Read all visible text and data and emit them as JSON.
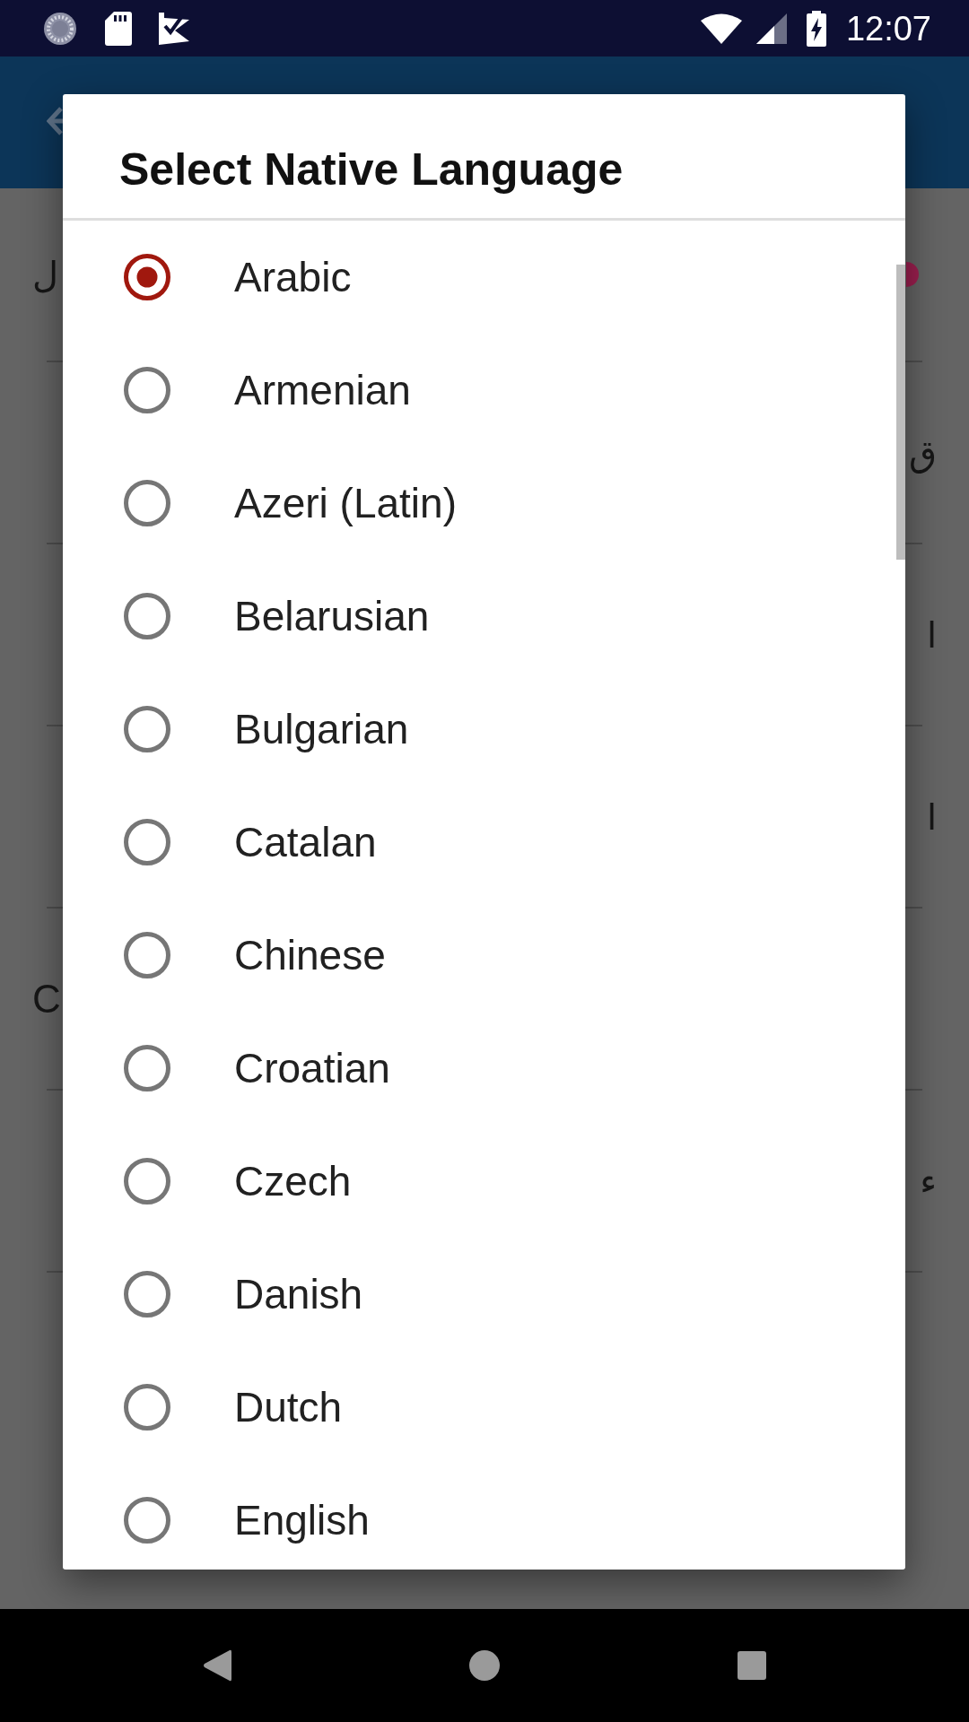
{
  "status_bar": {
    "time": "12:07"
  },
  "background_list": {
    "rows": [
      {
        "start_text": "ل",
        "badge_dot": true
      },
      {
        "end_text": "ق"
      },
      {
        "end_text": "ا"
      },
      {
        "end_text": "ا"
      },
      {
        "start_text": "C"
      },
      {
        "end_text": "ء"
      }
    ]
  },
  "dialog": {
    "title": "Select Native Language",
    "options": [
      {
        "label": "Arabic",
        "selected": true
      },
      {
        "label": "Armenian",
        "selected": false
      },
      {
        "label": "Azeri (Latin)",
        "selected": false
      },
      {
        "label": "Belarusian",
        "selected": false
      },
      {
        "label": "Bulgarian",
        "selected": false
      },
      {
        "label": "Catalan",
        "selected": false
      },
      {
        "label": "Chinese",
        "selected": false
      },
      {
        "label": "Croatian",
        "selected": false
      },
      {
        "label": "Czech",
        "selected": false
      },
      {
        "label": "Danish",
        "selected": false
      },
      {
        "label": "Dutch",
        "selected": false
      },
      {
        "label": "English",
        "selected": false
      }
    ]
  }
}
